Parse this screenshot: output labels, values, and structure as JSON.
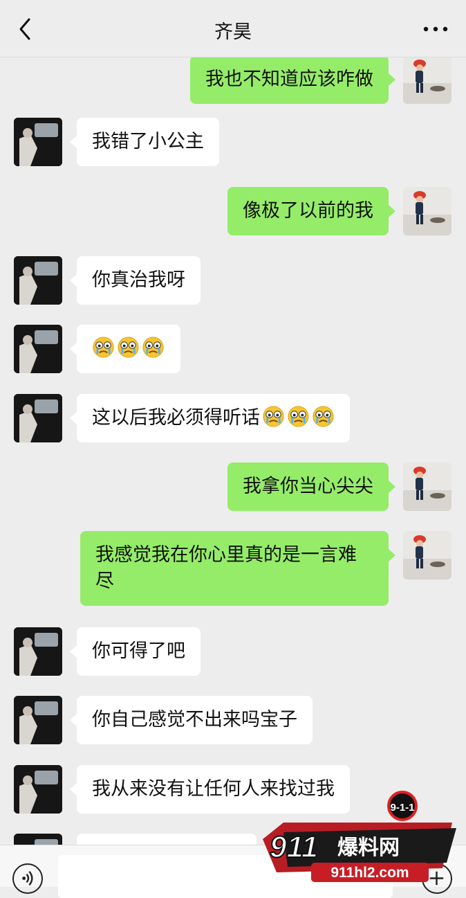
{
  "header": {
    "title": "齐昊"
  },
  "messages": [
    {
      "side": "right",
      "text": "我也不知道应该咋做"
    },
    {
      "side": "left",
      "text": "我错了小公主"
    },
    {
      "side": "right",
      "text": "像极了以前的我"
    },
    {
      "side": "left",
      "text": "你真治我呀"
    },
    {
      "side": "left",
      "text": "",
      "emoji": [
        "crying-face",
        "crying-face",
        "crying-face"
      ]
    },
    {
      "side": "left",
      "text": "这以后我必须得听话",
      "emoji": [
        "crying-face",
        "crying-face",
        "crying-face"
      ]
    },
    {
      "side": "right",
      "text": "我拿你当心尖尖"
    },
    {
      "side": "right",
      "text": "我感觉我在你心里真的是一言难尽"
    },
    {
      "side": "left",
      "text": "你可得了吧"
    },
    {
      "side": "left",
      "text": "你自己感觉不出来吗宝子"
    },
    {
      "side": "left",
      "text": "我从来没有让任何人来找过我"
    }
  ],
  "watermark": {
    "badge": "9-1-1",
    "brand_number": "911",
    "brand_text": "爆料网",
    "url": "911hl2.com"
  },
  "colors": {
    "sent_bubble": "#95ec69",
    "received_bubble": "#ffffff",
    "background": "#ededed"
  }
}
